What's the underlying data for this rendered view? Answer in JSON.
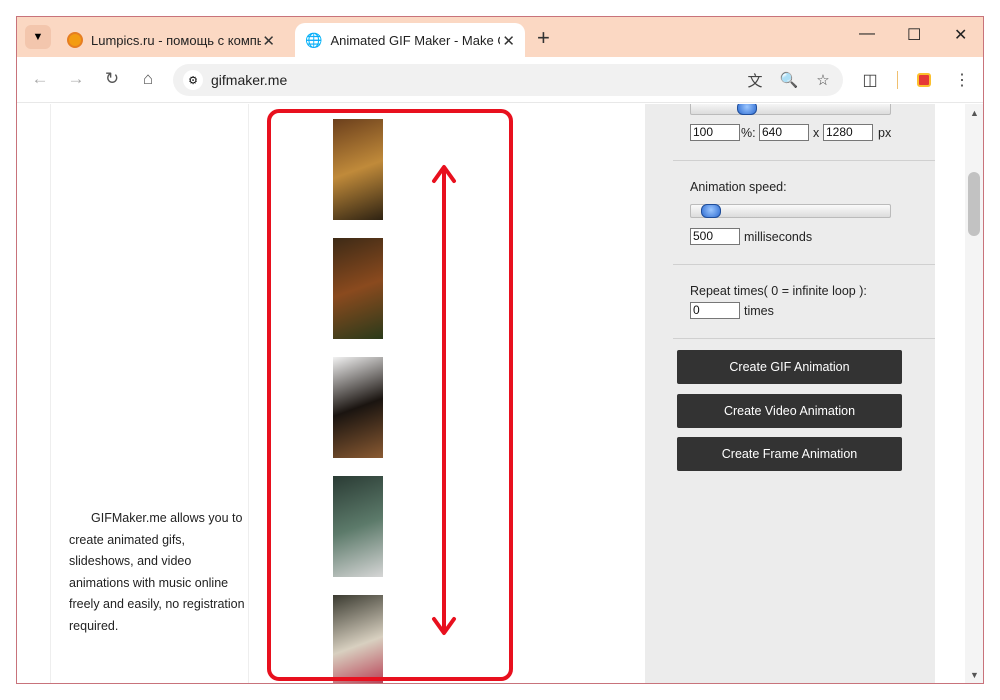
{
  "browser": {
    "tabs": [
      {
        "title": "Lumpics.ru - помощь с компьютером",
        "active": false
      },
      {
        "title": "Animated GIF Maker - Make GIF",
        "active": true
      }
    ],
    "new_tab": "+",
    "window_controls": {
      "minimize": "—",
      "maximize": "☐",
      "close": "✕"
    },
    "url": "gifmaker.me"
  },
  "page": {
    "description": "GIFMaker.me allows you to create animated gifs, slideshows, and video animations with music online freely and easily, no registration required.",
    "frames": [
      {
        "name": "autumn-tree-frame",
        "colors": [
          "#6b3f1c",
          "#c08a3a",
          "#2e2212"
        ]
      },
      {
        "name": "autumn-leaves-frame",
        "colors": [
          "#3d2a16",
          "#8a4a1e",
          "#2a3a1a"
        ]
      },
      {
        "name": "puppy-frame",
        "colors": [
          "#f2f2f2",
          "#1a1410",
          "#8a5a32"
        ]
      },
      {
        "name": "raccoon-frame",
        "colors": [
          "#2a3b34",
          "#5c7a6a",
          "#d6d6d6"
        ]
      },
      {
        "name": "butterfly-frame",
        "colors": [
          "#3a3a30",
          "#d8d0c0",
          "#b01c3a"
        ]
      }
    ],
    "size": {
      "percent": "100",
      "percent_sep": "%:",
      "width": "640",
      "x_sep": "x",
      "height": "1280",
      "unit": "px"
    },
    "speed": {
      "label": "Animation speed:",
      "value": "500",
      "unit": "milliseconds"
    },
    "repeat": {
      "label": "Repeat times( 0 = infinite loop ):",
      "value": "0",
      "unit": "times"
    },
    "buttons": {
      "create_gif": "Create GIF Animation",
      "create_video": "Create Video Animation",
      "create_frame": "Create Frame Animation"
    }
  },
  "colors": {
    "annotation": "#e8101e",
    "tabbar": "#fbd8c3",
    "button": "#333333",
    "panel": "#ececec"
  }
}
